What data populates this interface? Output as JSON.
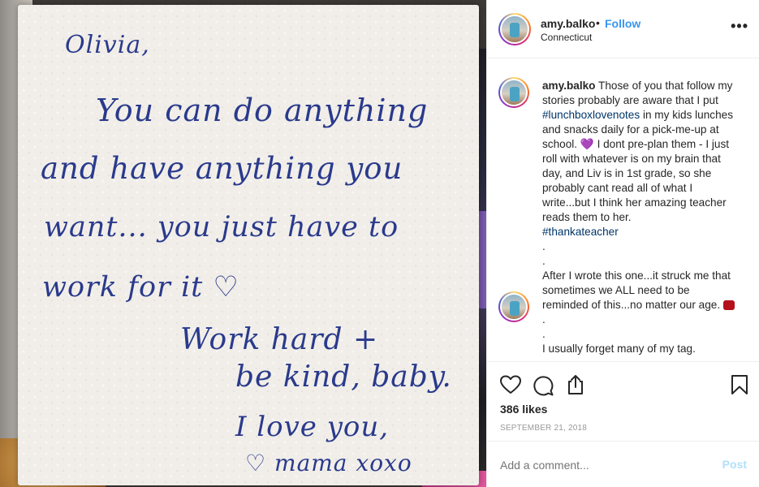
{
  "photo": {
    "alt": "handwritten napkin note",
    "note_lines": [
      "Olivia,",
      "You can do anything",
      "and have anything you",
      "want... you just have to",
      "work for it",
      "Work hard +",
      "be kind, baby.",
      "I love you,",
      "mama xoxo"
    ],
    "heart_glyph": "♡"
  },
  "header": {
    "username": "amy.balko",
    "separator": "•",
    "follow_label": "Follow",
    "location": "Connecticut",
    "more_icon": "more-horizontal-icon"
  },
  "caption": {
    "username": "amy.balko",
    "text_1": " Those of you that follow my stories probably are aware that I put ",
    "hashtag_1": "#lunchboxlovenotes",
    "text_2": " in my kids lunches and snacks daily for a pick-me-up at school. ",
    "emoji_heart": "💜",
    "text_3": " I dont pre-plan them - I just roll with whatever is on my brain that day, and Liv is in 1st grade, so she probably cant read all of what I write...but I think her amazing teacher reads them to her.",
    "hashtag_2": "#thankateacher",
    "dot_1": ".",
    "dot_2": ".",
    "text_4": "After I wrote this one...it struck me that sometimes we ALL need to be reminded of this...no matter our age.",
    "dot_3": ".",
    "dot_4": ".",
    "text_5": "I usually forget many of my tag."
  },
  "actions": {
    "like_icon": "heart-outline-icon",
    "comment_icon": "comment-icon",
    "share_icon": "share-icon",
    "save_icon": "bookmark-icon",
    "likes": "386 likes",
    "date": "SEPTEMBER 21, 2018"
  },
  "comment_box": {
    "placeholder": "Add a comment...",
    "post_label": "Post"
  },
  "colors": {
    "link_blue": "#3897f0",
    "hashtag_blue": "#003569",
    "post_disabled": "#b2dffc",
    "ink_blue": "#2a3a8c"
  }
}
